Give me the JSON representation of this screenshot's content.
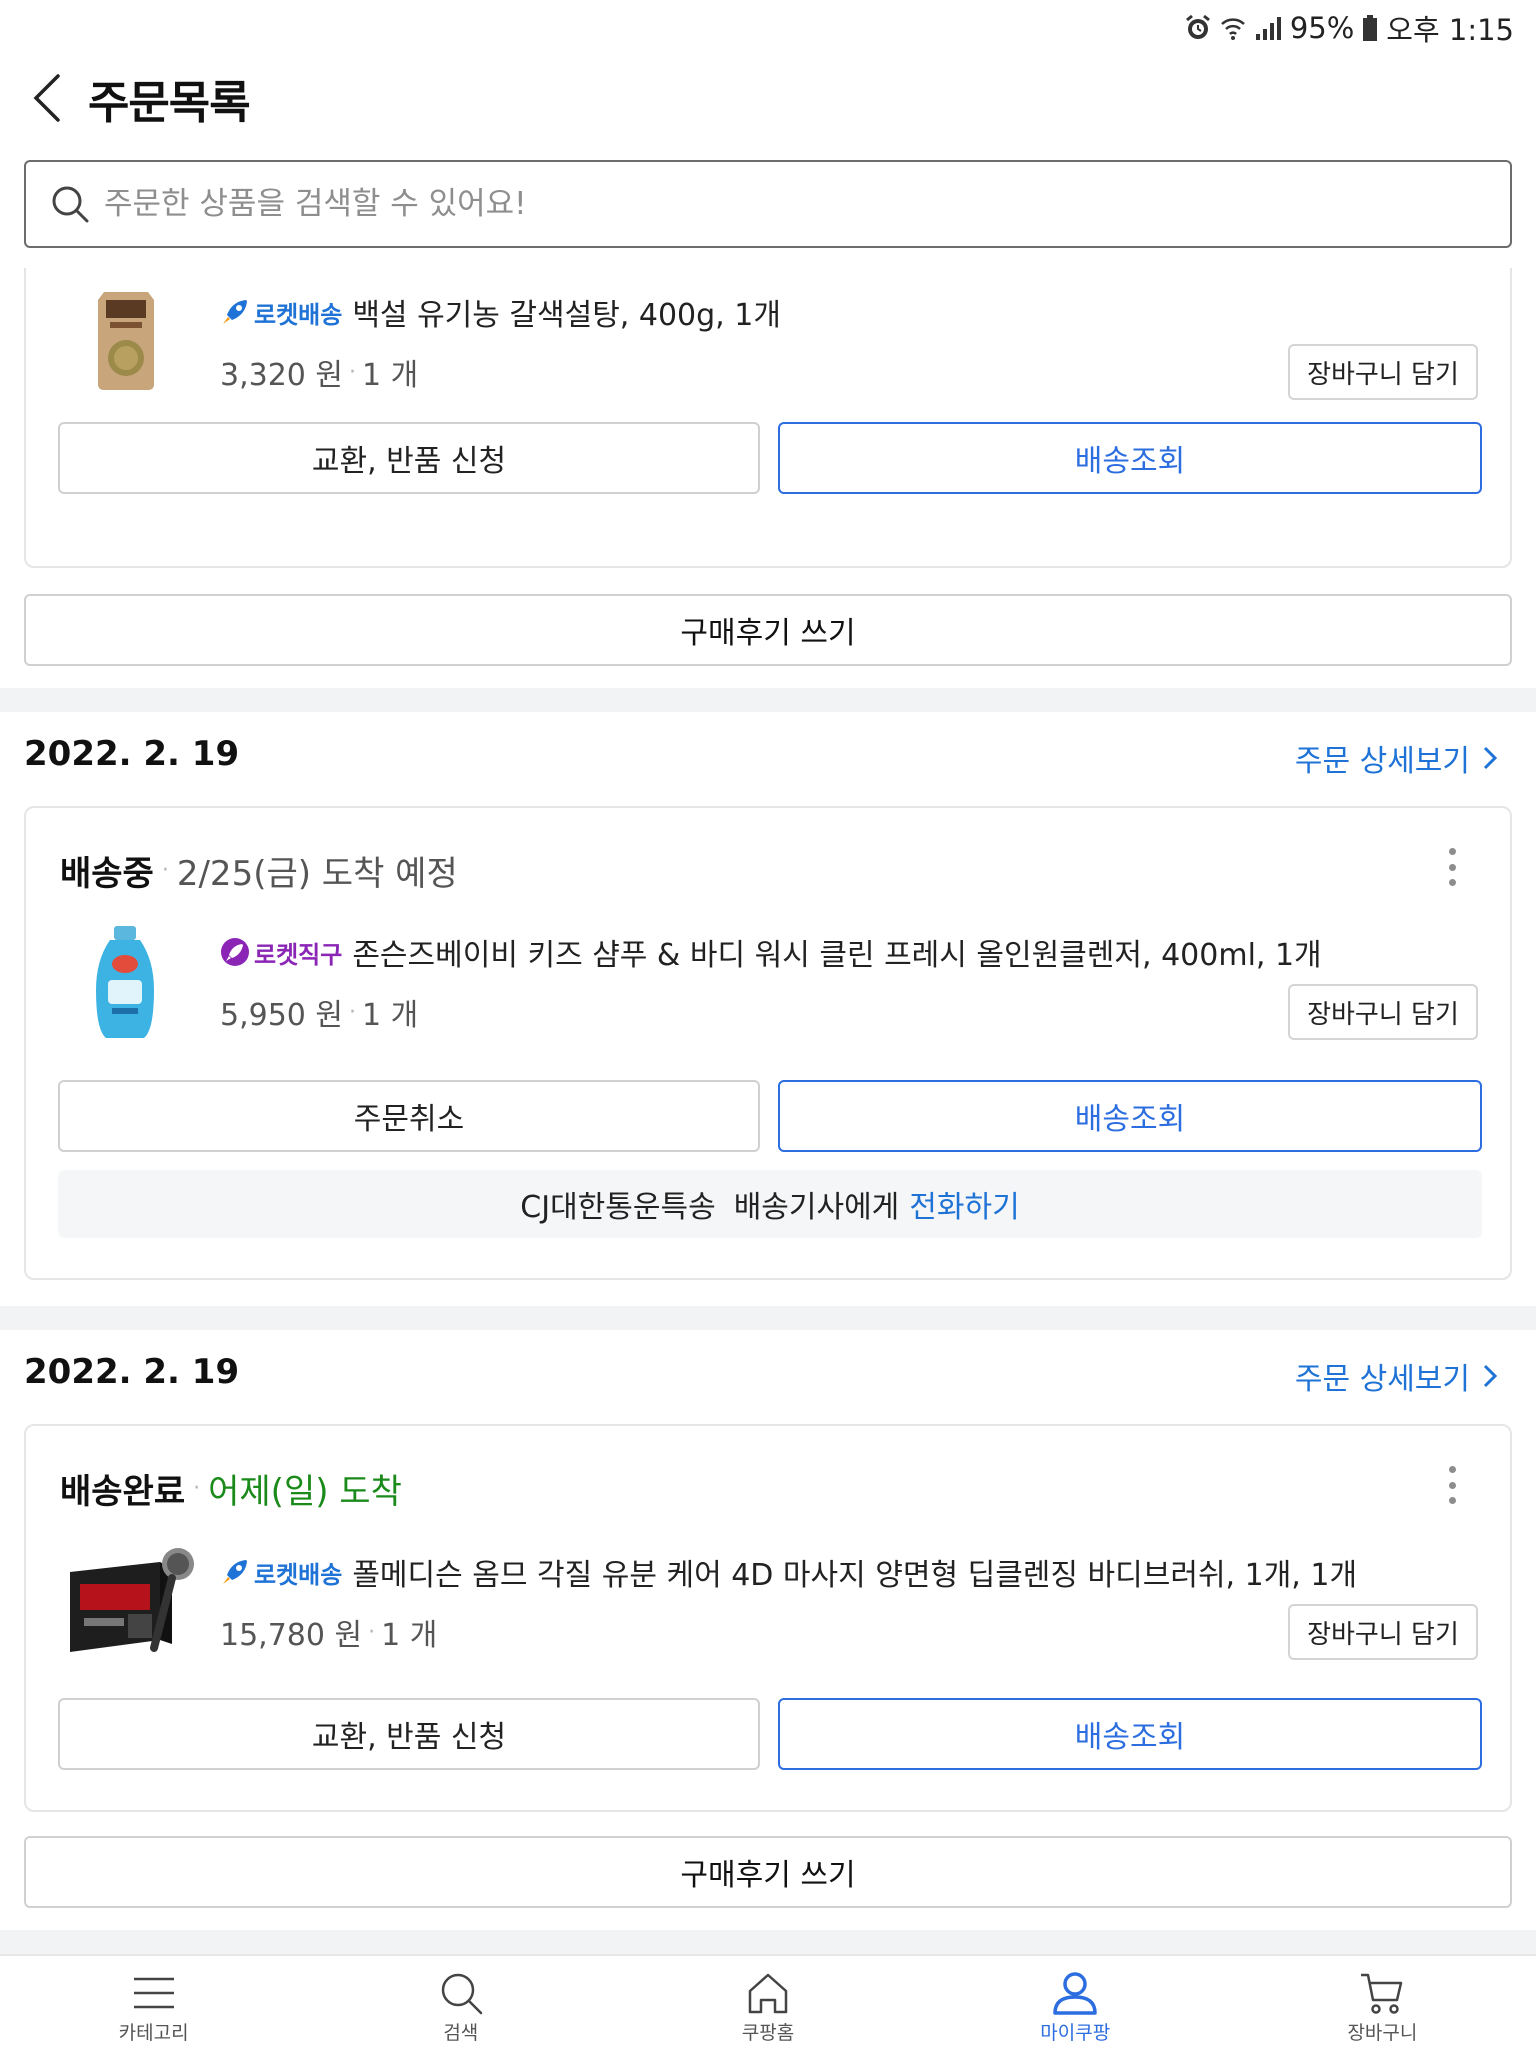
{
  "status_bar": {
    "battery": "95%",
    "time": "오후 1:15"
  },
  "header": {
    "title": "주문목록"
  },
  "search": {
    "placeholder": "주문한 상품을 검색할 수 있어요!"
  },
  "orders": [
    {
      "items": [
        {
          "badge": "로켓배송",
          "name": "백설 유기농 갈색설탕, 400g, 1개",
          "price": "3,320 원",
          "qty": "1 개",
          "cart_label": "장바구니 담기",
          "image_icon": "sugar-pouch"
        }
      ],
      "buttons": [
        "교환, 반품 신청",
        "배송조회"
      ],
      "review_label": "구매후기 쓰기"
    },
    {
      "date": "2022. 2. 19",
      "detail_label": "주문 상세보기",
      "status": "배송중",
      "eta": "2/25(금) 도착 예정",
      "items": [
        {
          "badge": "로켓직구",
          "name": "존슨즈베이비 키즈 샴푸 & 바디 워시 클린 프레시 올인원클렌저, 400ml, 1개",
          "price": "5,950 원",
          "qty": "1 개",
          "cart_label": "장바구니 담기",
          "image_icon": "shampoo-bottle"
        }
      ],
      "buttons": [
        "주문취소",
        "배송조회"
      ],
      "courier": {
        "company": "CJ대한통운특송",
        "label": "배송기사에게",
        "action": "전화하기"
      }
    },
    {
      "date": "2022. 2. 19",
      "detail_label": "주문 상세보기",
      "status": "배송완료",
      "eta": "어제(일) 도착",
      "items": [
        {
          "badge": "로켓배송",
          "name": "폴메디슨 옴므 각질 유분 케어 4D 마사지 양면형 딥클렌징 바디브러쉬, 1개, 1개",
          "price": "15,780 원",
          "qty": "1 개",
          "cart_label": "장바구니 담기",
          "image_icon": "body-brush-box"
        }
      ],
      "buttons": [
        "교환, 반품 신청",
        "배송조회"
      ],
      "review_label": "구매후기 쓰기"
    }
  ],
  "tabbar": [
    {
      "label": "카테고리",
      "icon": "menu-icon"
    },
    {
      "label": "검색",
      "icon": "search-icon"
    },
    {
      "label": "쿠팡홈",
      "icon": "home-icon"
    },
    {
      "label": "마이쿠팡",
      "icon": "person-icon",
      "active": true
    },
    {
      "label": "장바구니",
      "icon": "cart-icon"
    }
  ],
  "colors": {
    "accent": "#2c6de0",
    "link": "#1f73d6",
    "delivered": "#1a8a1a",
    "jikgu": "#8a25b5"
  }
}
